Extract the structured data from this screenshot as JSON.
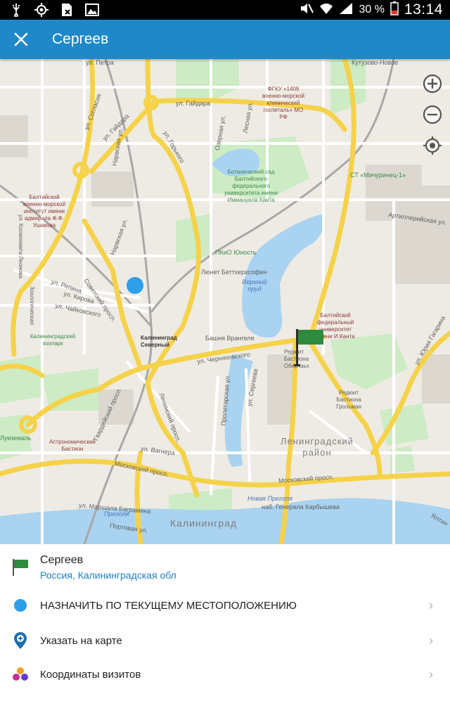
{
  "status_bar": {
    "battery": "30 %",
    "time": "13:14",
    "icons": [
      "usb-icon",
      "gps-icon",
      "sim-off-icon",
      "gallery-icon",
      "mute-icon",
      "wifi-icon",
      "signal-icon",
      "battery-icon"
    ]
  },
  "app_bar": {
    "title": "Сергеев",
    "close_icon": "close-icon"
  },
  "map": {
    "zoom_in_icon": "plus-circle-icon",
    "zoom_out_icon": "minus-circle-icon",
    "my_location_icon": "crosshair-icon",
    "labels": {
      "petra": "ул. Петра",
      "kutuzovo": "Кутузово-Новое",
      "gospital": "ФГКУ «1409 военно-морской клинический госпиталь» МО РФ",
      "gaydara1": "ул. Гайдара",
      "gaydara2": "ул. Гайдара",
      "soglasiya": "ул. Согласия",
      "narvskaya1": "Нарвская ул.",
      "narvskaya2": "Нарвская ул.",
      "gorkogo": "ул. Горького",
      "ozernaya": "Озерная ул.",
      "lesnaya": "Лесная ул.",
      "botsad": "Ботанический сад Балтийского федерального университета имени Иммануила Канта",
      "michurinets": "СТ «Мичуринец-1»",
      "institute": "Балтийский военно-морской институт имени адмирала Ф.Ф. Ушакова",
      "artilleriyskaya": "Артиллерийская ул.",
      "kosmonavta": "ул. Космонавта Леонова",
      "pkio": "ПКиО Юность",
      "lunet": "Люнет Беттхерхсофен",
      "verkhniy_prud": "Верхний пруд",
      "sovetskiy": "Советский просп.",
      "repina": "ул. Репина",
      "kirova": "ул. Кирова",
      "chaykovskogo": "ул. Чайковского",
      "zoologicheskaya": "Зоологическая",
      "bfu": "Балтийский федеральный университет имени И.Канта",
      "zoopark": "Калининградский зоопарк",
      "station": "Калининград Северный",
      "bashnya": "Башня Врангеля",
      "chernyakhovskogo": "ул. Черняховского",
      "redut_obertaly": "Редюит Бастиона Обертаьх",
      "gagarina": "ул. Юрия Гагарина",
      "gvardeyskiy": "Гвардейский просп.",
      "leninskiy": "Ленинский просп.",
      "proletarskaya": "Пролетарская ул.",
      "sergeeva": "ул. Сергеева",
      "redut_grolman": "Редюит Бастиона Грольман",
      "ruzeval": "Луизеваль",
      "astro": "Астрономический Бастион",
      "vagnera": "ул. Вагнера",
      "leningradskiy": "Ленинградский район",
      "moskovskiy1": "Московский просп.",
      "moskovskiy2": "Московский просп.",
      "novaya_pregolya": "Новая Преголя",
      "pregolya": "Преголя",
      "bagramyana": "ул. Маршала Баграмяна",
      "karbysheva": "наб. Генерала Карбышева",
      "portovaya": "Портовая ул.",
      "kaliningrad": "Калининград",
      "yaltinskaya": "Ялтин"
    }
  },
  "sheet": {
    "place": {
      "icon": "green-flag-icon",
      "title": "Сергеев",
      "subtitle": "Россия, Калининградская обл"
    },
    "options": [
      {
        "icon": "blue-dot-icon",
        "label": "НАЗНАЧИТЬ ПО ТЕКУЩЕМУ МЕСТОПОЛОЖЕНИЮ"
      },
      {
        "icon": "map-pin-plus-icon",
        "label": "Указать на карте"
      },
      {
        "icon": "colored-dots-icon",
        "label": "Координаты визитов"
      }
    ],
    "chevron": "›"
  },
  "colors": {
    "app_bar": "#1e88c9",
    "accent_blue": "#2d9ee8",
    "flag_green": "#2e8b3e",
    "road_yellow": "#f5d24a",
    "water": "#a9d3f0",
    "park": "#cdebc4"
  }
}
